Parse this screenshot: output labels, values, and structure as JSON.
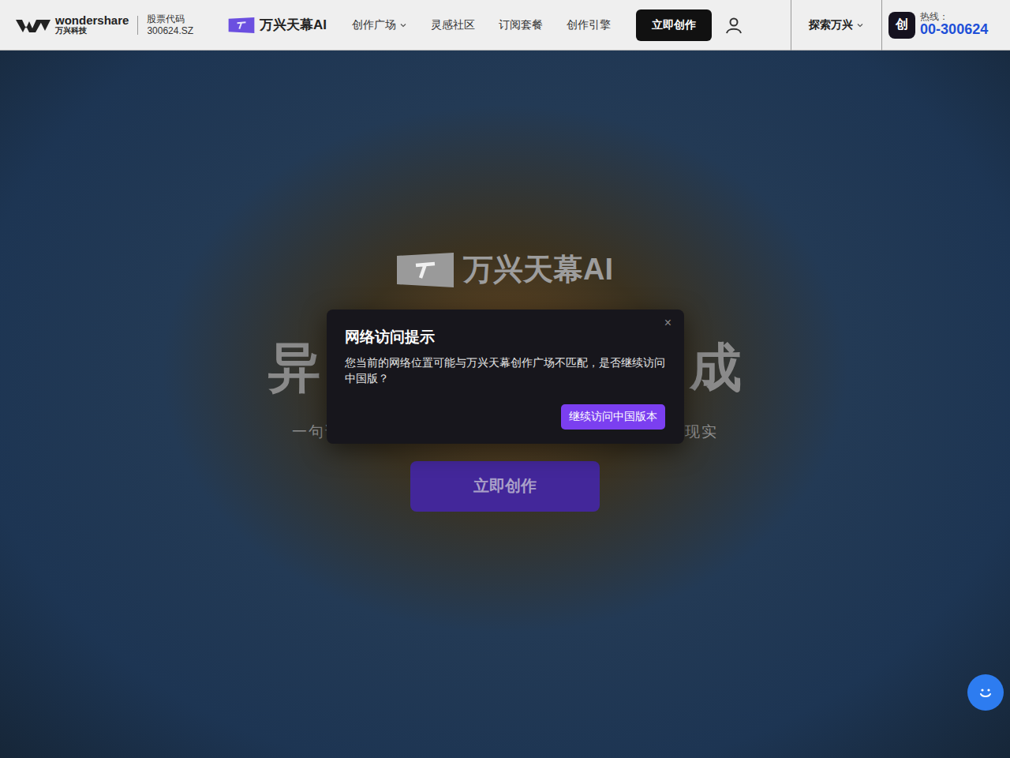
{
  "header": {
    "brand": "wondershare",
    "brand_cn": "万兴科技",
    "stock_label": "股票代码",
    "stock_code": "300624.SZ",
    "product": "万兴天幕AI",
    "nav": [
      {
        "label": "创作广场",
        "dropdown": true
      },
      {
        "label": "灵感社区",
        "dropdown": false
      },
      {
        "label": "订阅套餐",
        "dropdown": false
      },
      {
        "label": "创作引擎",
        "dropdown": false
      }
    ],
    "cta": "立即创作",
    "explore": "探索万兴",
    "hotline_label": "热线：",
    "hotline": "00-300624",
    "app_badge": "创"
  },
  "hero": {
    "logo_text": "万兴天幕AI",
    "headline_left": "异",
    "headline_right": "成",
    "subtitle": "一句话生成视频/图片/音乐，全AI创作流程，灵感秒变现实",
    "cta": "立即创作"
  },
  "dialog": {
    "title": "网络访问提示",
    "message": "您当前的网络位置可能与万兴天幕创作广场不匹配，是否继续访问中国版？",
    "close": "×",
    "button": "继续访问中国版本"
  }
}
